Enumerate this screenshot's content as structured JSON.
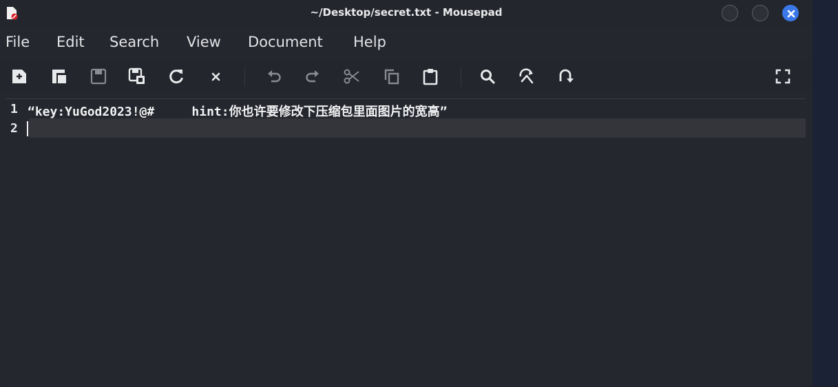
{
  "window": {
    "title": "~/Desktop/secret.txt - Mousepad"
  },
  "menubar": {
    "items": [
      "File",
      "Edit",
      "Search",
      "View",
      "Document",
      "Help"
    ]
  },
  "toolbar": {
    "buttons": [
      "new-document-icon",
      "new-window-icon",
      "save-icon",
      "save-as-icon",
      "reload-icon",
      "close-document-icon",
      "undo-icon",
      "redo-icon",
      "cut-icon",
      "copy-icon",
      "paste-icon",
      "find-icon",
      "find-replace-icon",
      "go-to-line-icon",
      "fullscreen-icon"
    ]
  },
  "editor": {
    "lines": [
      {
        "number": "1",
        "text": "“key:YuGod2023!@#     hint:你也许要修改下压缩包里面图片的宽高”"
      },
      {
        "number": "2",
        "text": ""
      }
    ],
    "current_line": 2
  },
  "colors": {
    "background": "#25272e",
    "current_line": "#33353b",
    "close_button": "#3b78e7"
  }
}
